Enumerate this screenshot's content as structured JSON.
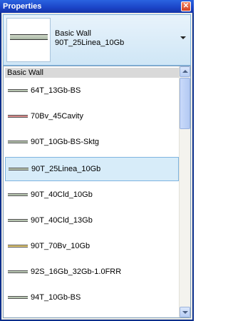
{
  "window": {
    "title": "Properties",
    "close_glyph": "✕"
  },
  "type_selector": {
    "family": "Basic Wall",
    "type": "90T_25Linea_10Gb",
    "dropdown_icon": "chevron-down-icon"
  },
  "list": {
    "family_header": "Basic Wall",
    "items": [
      {
        "label": "64T_13Gb-BS",
        "swatch_color": "#b8c6b1",
        "selected": false
      },
      {
        "label": "70Bv_45Cavity",
        "swatch_color": "#d98a8a",
        "selected": false
      },
      {
        "label": "90T_10Gb-BS-Sktg",
        "swatch_color": "#b8c6b1",
        "selected": false
      },
      {
        "label": "90T_25Linea_10Gb",
        "swatch_color": "#b8c6b1",
        "selected": true
      },
      {
        "label": "90T_40Cld_10Gb",
        "swatch_color": "#b8c6b1",
        "selected": false
      },
      {
        "label": "90T_40Cld_13Gb",
        "swatch_color": "#b8c6b1",
        "selected": false
      },
      {
        "label": "90T_70Bv_10Gb",
        "swatch_color": "#e3c870",
        "selected": false
      },
      {
        "label": "92S_16Gb_32Gb-1.0FRR",
        "swatch_color": "#b8c6b1",
        "selected": false
      },
      {
        "label": "94T_10Gb-BS",
        "swatch_color": "#b8c6b1",
        "selected": false
      }
    ]
  },
  "colors": {
    "titlebar": "#1b44c7",
    "selection": "#d7ecf9",
    "selection_border": "#7eb4e0"
  }
}
